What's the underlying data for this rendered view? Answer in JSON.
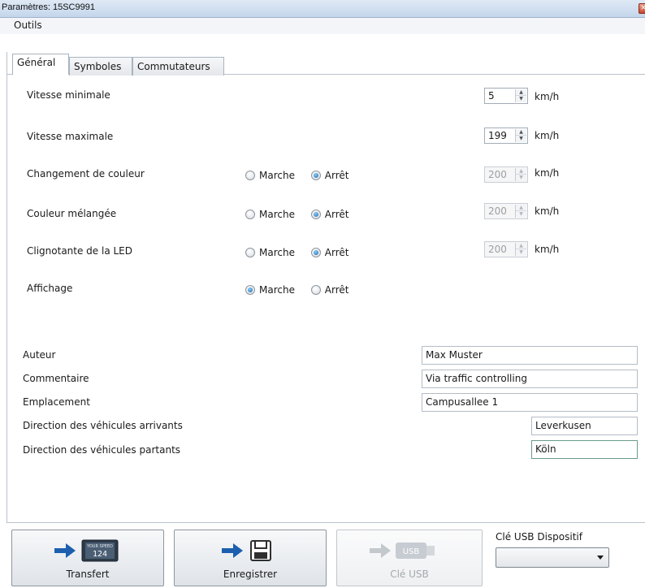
{
  "window": {
    "title": "Paramètres: 15SC9991",
    "close_glyph": "×"
  },
  "menu": {
    "items": [
      "Outils"
    ]
  },
  "tabs": [
    {
      "label": "Général",
      "active": true
    },
    {
      "label": "Symboles",
      "active": false
    },
    {
      "label": "Commutateurs",
      "active": false
    }
  ],
  "radio_labels": {
    "on": "Marche",
    "off": "Arrêt"
  },
  "settings": {
    "vitesse_min": {
      "label": "Vitesse minimale",
      "value": "5",
      "unit": "km/h"
    },
    "vitesse_max": {
      "label": "Vitesse maximale",
      "value": "199",
      "unit": "km/h"
    },
    "changement_couleur": {
      "label": "Changement de couleur",
      "selected": "Arrêt",
      "value": "200",
      "unit": "km/h",
      "enabled": false
    },
    "couleur_melangee": {
      "label": "Couleur mélangée",
      "selected": "Arrêt",
      "value": "200",
      "unit": "km/h",
      "enabled": false
    },
    "clignotante_led": {
      "label": "Clignotante de la LED",
      "selected": "Arrêt",
      "value": "200",
      "unit": "km/h",
      "enabled": false
    },
    "affichage": {
      "label": "Affichage",
      "selected": "Marche"
    }
  },
  "info": {
    "auteur": {
      "label": "Auteur",
      "value": "Max Muster"
    },
    "commentaire": {
      "label": "Commentaire",
      "value": "Via traffic controlling"
    },
    "emplacement": {
      "label": "Emplacement",
      "value": "Campusallee 1"
    },
    "direction_arrivants": {
      "label": "Direction des véhicules arrivants",
      "value": "Leverkusen"
    },
    "direction_partants": {
      "label": "Direction des véhicules partants",
      "value": "Köln"
    }
  },
  "footer": {
    "transfert": {
      "label": "Transfert",
      "display_caption": "YOUR SPEED",
      "display_value": "124"
    },
    "enregistrer": {
      "label": "Enregistrer"
    },
    "cle_usb": {
      "label": "Clé USB",
      "badge": "USB",
      "enabled": false
    },
    "usb_device": {
      "label": "Clé USB Dispositif",
      "selected": ""
    }
  },
  "colors": {
    "arrow": "#1b5fae",
    "accent_radio": "#1c62b0",
    "titlebar": "#c4d6ec"
  },
  "icons": [
    "close-icon",
    "arrow-right-icon",
    "speed-display-icon",
    "floppy-disk-icon",
    "usb-stick-icon",
    "chevron-down-icon"
  ]
}
